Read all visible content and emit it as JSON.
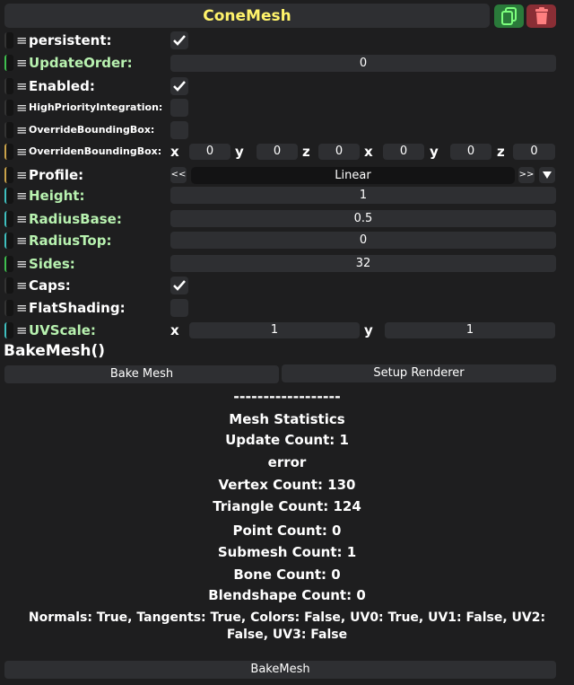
{
  "header": {
    "title": "ConeMesh",
    "copy_icon": "copy-icon",
    "delete_icon": "trash-icon"
  },
  "colors": {
    "title": "#fff36b",
    "sync_label": "#b8f2b0",
    "copy_button": "#2a7a3a",
    "delete_button": "#8a2e35"
  },
  "fields": {
    "persistent": {
      "label": "persistent:",
      "checked": true
    },
    "update_order": {
      "label": "UpdateOrder:",
      "value": "0"
    },
    "enabled": {
      "label": "Enabled:",
      "checked": true
    },
    "high_priority": {
      "label": "HighPriorityIntegration:",
      "checked": false
    },
    "override_bbox": {
      "label": "OverrideBoundingBox:",
      "checked": false
    },
    "overriden_bbox": {
      "label": "OverridenBoundingBox:",
      "min": {
        "x": "0",
        "y": "0",
        "z": "0"
      },
      "max": {
        "x": "0",
        "y": "0",
        "z": "0"
      }
    },
    "profile": {
      "label": "Profile:",
      "value": "Linear",
      "prev": "<<",
      "next": ">>"
    },
    "height": {
      "label": "Height:",
      "value": "1"
    },
    "radius_base": {
      "label": "RadiusBase:",
      "value": "0.5"
    },
    "radius_top": {
      "label": "RadiusTop:",
      "value": "0"
    },
    "sides": {
      "label": "Sides:",
      "value": "32"
    },
    "caps": {
      "label": "Caps:",
      "checked": true
    },
    "flat_shading": {
      "label": "FlatShading:",
      "checked": false
    },
    "uv_scale": {
      "label": "UVScale:",
      "x": "1",
      "y": "1"
    }
  },
  "axis": {
    "x": "x",
    "y": "y",
    "z": "z"
  },
  "bake": {
    "title": "BakeMesh()",
    "bake_button": "Bake Mesh",
    "setup_button": "Setup Renderer"
  },
  "stats": {
    "divider": "------------------",
    "heading": "Mesh Statistics",
    "update_count": "Update Count: 1",
    "error": "error",
    "vertex_count": "Vertex Count: 130",
    "triangle_count": "Triangle Count: 124",
    "point_count": "Point Count: 0",
    "submesh_count": "Submesh Count: 1",
    "bone_count": "Bone Count: 0",
    "blendshape_count": "Blendshape Count: 0",
    "attributes_line1": "Normals: True, Tangents: True, Colors: False, UV0: True, UV1: False, UV2:",
    "attributes_line2": "False, UV3: False"
  },
  "bottom_button": "BakeMesh"
}
